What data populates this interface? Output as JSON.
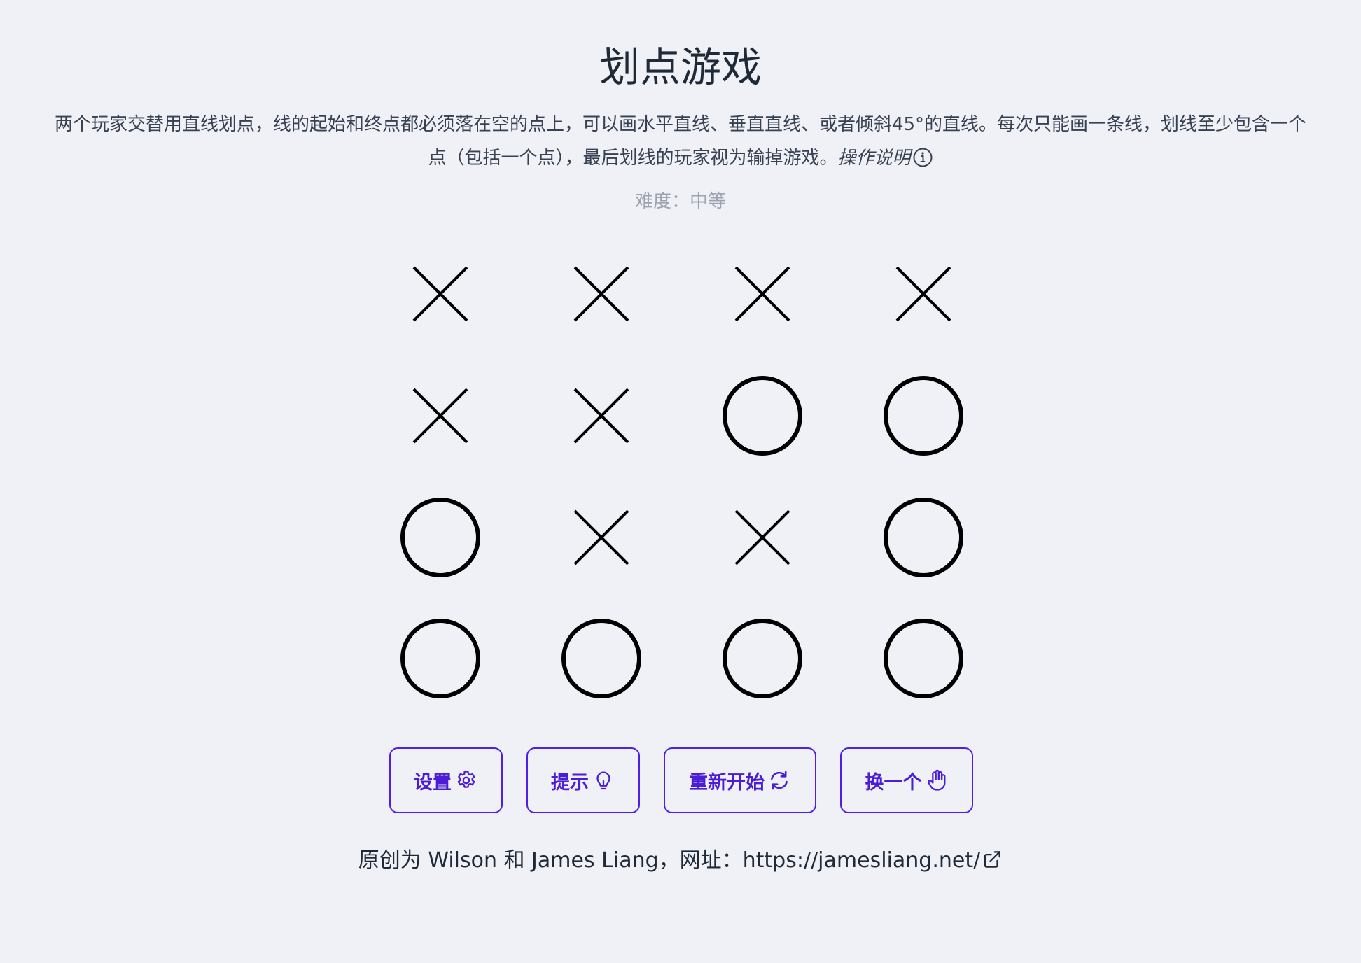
{
  "header": {
    "title": "划点游戏",
    "description": "两个玩家交替用直线划点，线的起始和终点都必须落在空的点上，可以画水平直线、垂直直线、或者倾斜45°的直线。每次只能画一条线，划线至少包含一个点（包括一个点），最后划线的玩家视为输掉游戏。",
    "help_link": "操作说明",
    "help_icon": "info-icon"
  },
  "status": {
    "difficulty": "难度：中等"
  },
  "board": {
    "rows": 4,
    "cols": 4,
    "cells": [
      [
        "X",
        "X",
        "X",
        "X"
      ],
      [
        "X",
        "X",
        "O",
        "O"
      ],
      [
        "O",
        "X",
        "X",
        "O"
      ],
      [
        "O",
        "O",
        "O",
        "O"
      ]
    ]
  },
  "buttons": [
    {
      "label": "设置",
      "icon": "gear-icon"
    },
    {
      "label": "提示",
      "icon": "lightbulb-icon"
    },
    {
      "label": "重新开始",
      "icon": "refresh-icon"
    },
    {
      "label": "换一个",
      "icon": "hand-icon"
    }
  ],
  "footer": {
    "text": "原创为 Wilson 和 James Liang，网址：",
    "link": "https://jamesliang.net/",
    "link_icon": "external-link-icon"
  },
  "colors": {
    "background": "#eff1f6",
    "accent": "#4f1fe8",
    "muted": "#9ca3af"
  }
}
